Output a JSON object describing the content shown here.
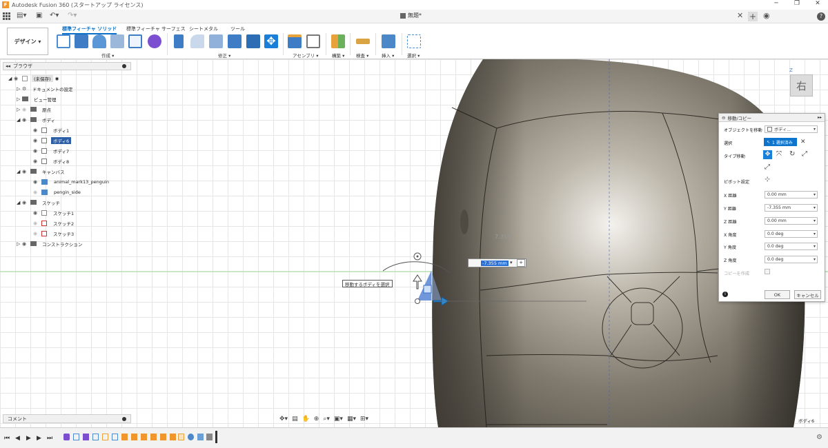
{
  "window": {
    "title": "Autodesk Fusion 360 (スタートアップ ライセンス)",
    "app_letter": "F",
    "minimize": "─",
    "maximize": "❐",
    "close": "✕"
  },
  "document": {
    "title": "無題*"
  },
  "toolbar": {
    "workspace": "デザイン ▾",
    "tabs": [
      "標準フィーチャ ソリッド",
      "標準フィーチャ サーフェス",
      "シートメタル",
      "ツール"
    ],
    "groups": [
      "作成 ▾",
      "修正 ▾",
      "アセンブリ ▾",
      "構築 ▾",
      "検査 ▾",
      "挿入 ▾",
      "選択 ▾"
    ]
  },
  "browser": {
    "header": "ブラウザ",
    "rows": [
      {
        "label": "(未保存)",
        "style": "hl"
      },
      {
        "label": "ドキュメントの設定"
      },
      {
        "label": "ビュー管理"
      },
      {
        "label": "原点"
      },
      {
        "label": "ボディ"
      },
      {
        "label": "ボディ1"
      },
      {
        "label": "ボディ6",
        "style": "sel"
      },
      {
        "label": "ボディ7"
      },
      {
        "label": "ボディ8"
      },
      {
        "label": "キャンバス"
      },
      {
        "label": "animal_mark13_penguin"
      },
      {
        "label": "pengin_side"
      },
      {
        "label": "スケッチ"
      },
      {
        "label": "スケッチ1"
      },
      {
        "label": "スケッチ2"
      },
      {
        "label": "スケッチ3"
      },
      {
        "label": "コンストラクション"
      }
    ]
  },
  "comment": {
    "label": "コメント"
  },
  "viewcube": {
    "face": "右",
    "axis": "Z"
  },
  "viewport": {
    "hint": "移動するボディを選択",
    "dimension": "7.355",
    "input_value": "-7.355 mm",
    "body_label": "ボディ6"
  },
  "panel": {
    "title": "移動/コピー",
    "object_label": "オブジェクトを移動",
    "object_value": "ボディ...",
    "selection_label": "選択",
    "selection_value": "1 選択済み",
    "type_label": "タイプ移動",
    "pivot_label": "ピボット設定",
    "fields": [
      {
        "label": "X 距離",
        "value": "0.00 mm"
      },
      {
        "label": "Y 距離",
        "value": "-7.355 mm"
      },
      {
        "label": "Z 距離",
        "value": "0.00 mm"
      },
      {
        "label": "X 角度",
        "value": "0.0 deg"
      },
      {
        "label": "Y 角度",
        "value": "0.0 deg"
      },
      {
        "label": "Z 角度",
        "value": "0.0 deg"
      }
    ],
    "copy_label": "コピーを作成",
    "ok": "OK",
    "cancel": "キャンセル"
  },
  "colors": {
    "accent": "#0a6fc9",
    "selection": "#2a5fa8",
    "body_fill": "#7d776b"
  }
}
